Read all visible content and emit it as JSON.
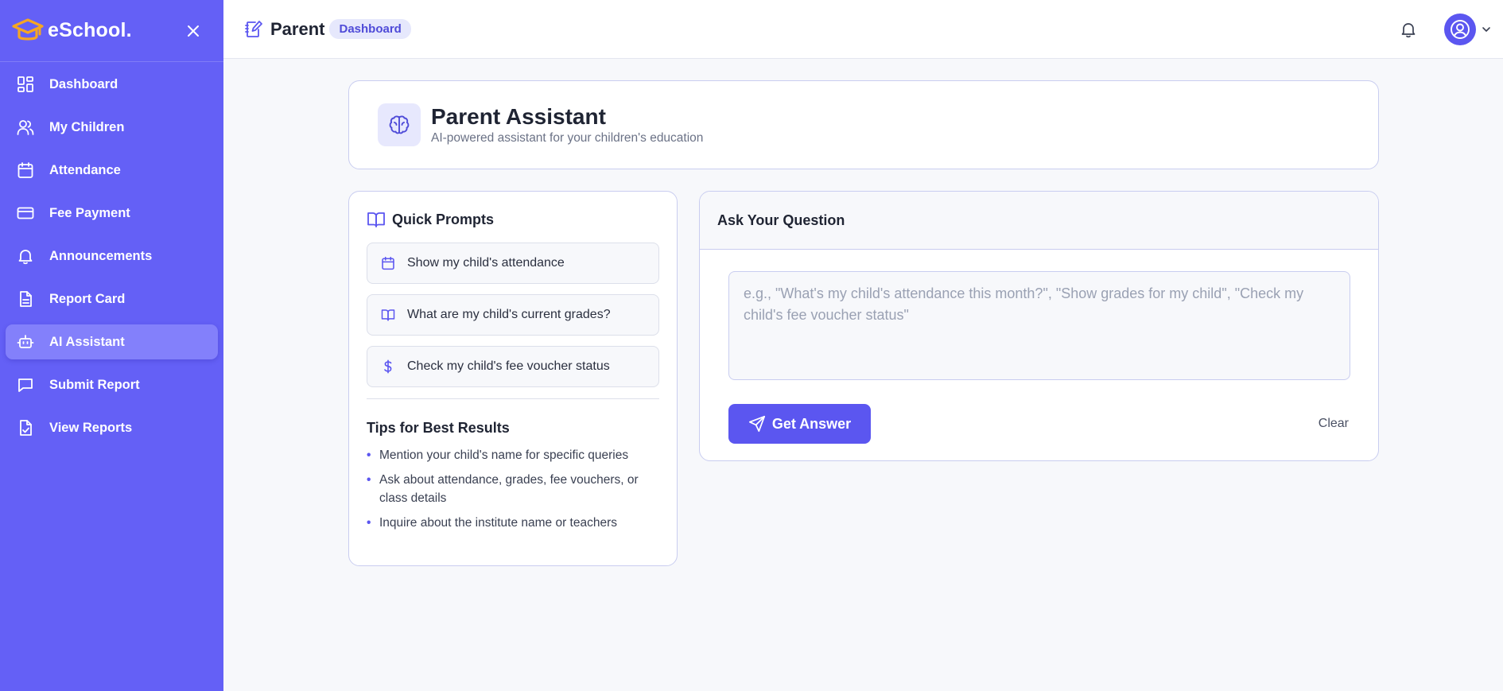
{
  "sidebar": {
    "brand": "eSchool.",
    "items": [
      {
        "label": "Dashboard",
        "icon": "grid-icon"
      },
      {
        "label": "My Children",
        "icon": "users-icon"
      },
      {
        "label": "Attendance",
        "icon": "calendar-icon"
      },
      {
        "label": "Fee Payment",
        "icon": "credit-card-icon"
      },
      {
        "label": "Announcements",
        "icon": "bell-icon"
      },
      {
        "label": "Report Card",
        "icon": "document-icon"
      },
      {
        "label": "AI Assistant",
        "icon": "bot-icon",
        "active": true
      },
      {
        "label": "Submit Report",
        "icon": "message-square-icon"
      },
      {
        "label": "View Reports",
        "icon": "file-check-icon"
      }
    ]
  },
  "topbar": {
    "title": "Parent",
    "badge": "Dashboard"
  },
  "header": {
    "title": "Parent Assistant",
    "subtitle": "AI-powered assistant for your children's education"
  },
  "quick_prompts": {
    "title": "Quick Prompts",
    "items": [
      {
        "label": "Show my child's attendance",
        "icon": "calendar-icon"
      },
      {
        "label": "What are my child's current grades?",
        "icon": "book-open-icon"
      },
      {
        "label": "Check my child's fee voucher status",
        "icon": "dollar-icon"
      }
    ]
  },
  "tips": {
    "title": "Tips for Best Results",
    "items": [
      "Mention your child's name for specific queries",
      "Ask about attendance, grades, fee vouchers, or class details",
      "Inquire about the institute name or teachers"
    ]
  },
  "ask": {
    "title": "Ask Your Question",
    "placeholder": "e.g., \"What's my child's attendance this month?\", \"Show grades for my child\", \"Check my child's fee voucher status\"",
    "value": "",
    "submit_label": "Get Answer",
    "clear_label": "Clear"
  },
  "colors": {
    "sidebar_bg": "#6460f6",
    "accent": "#5b56f0",
    "logo": "#f5a623"
  }
}
